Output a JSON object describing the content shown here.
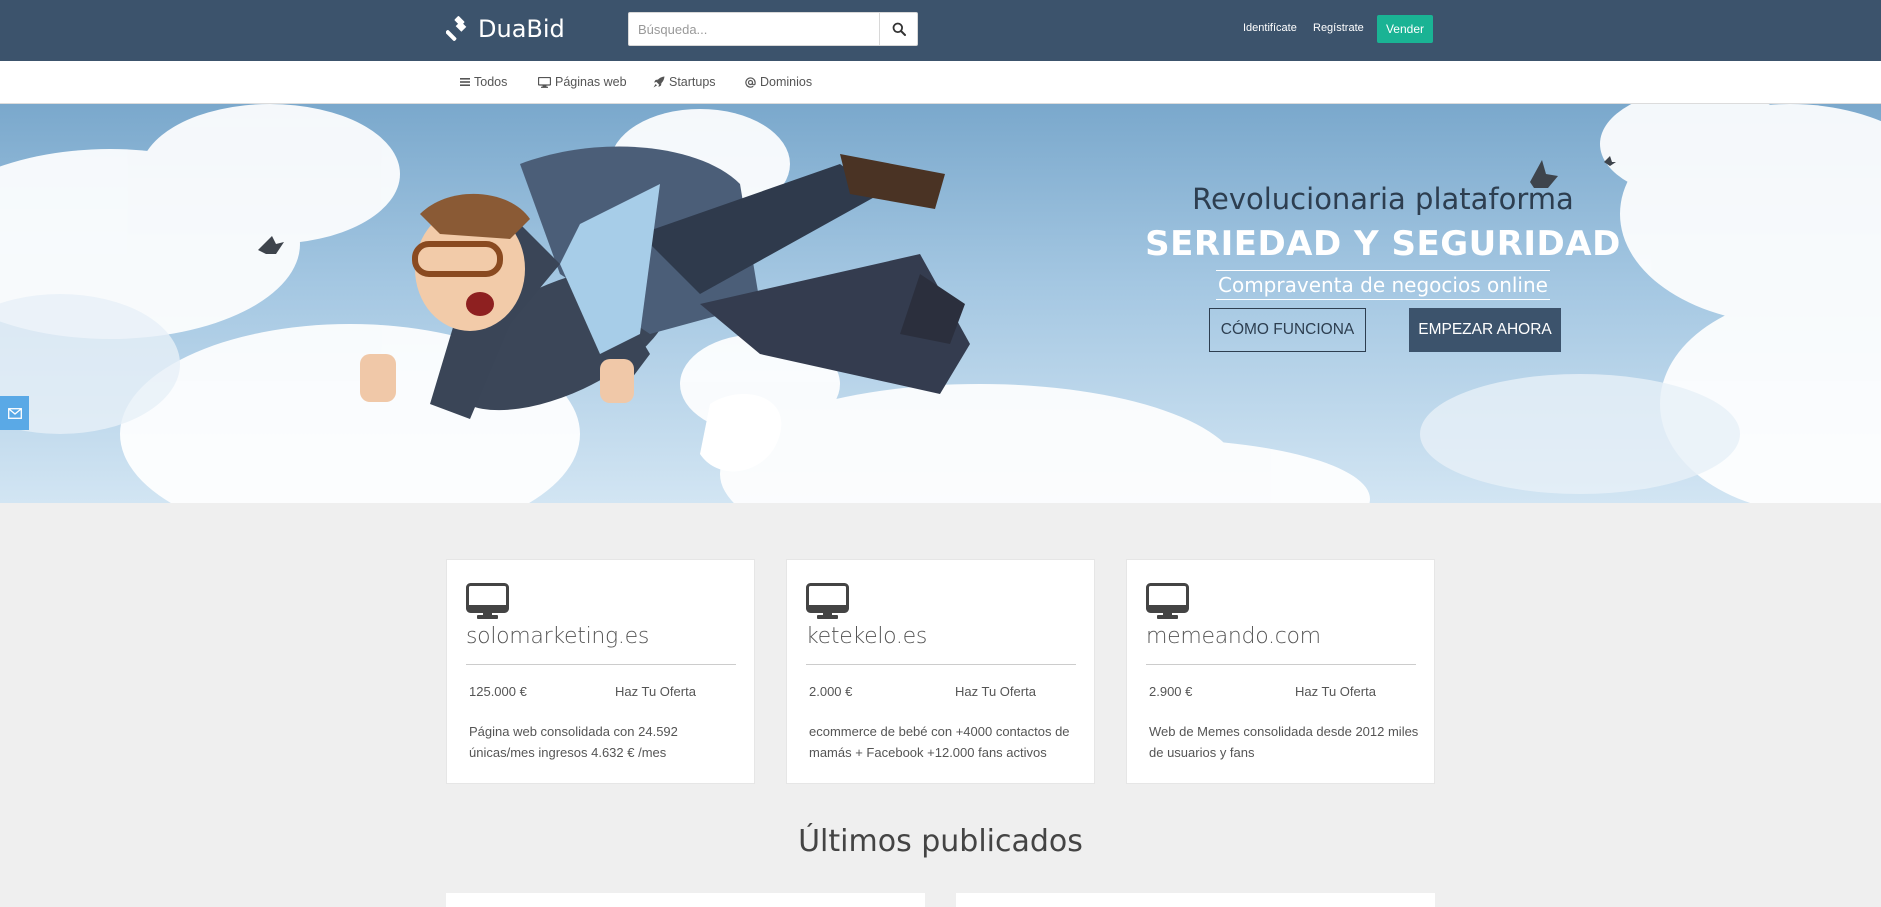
{
  "header": {
    "brand": "DuaBid",
    "search_placeholder": "Búsqueda...",
    "login_label": "Identifícate",
    "register_label": "Regístrate",
    "sell_label": "Vender"
  },
  "subnav": {
    "items": [
      {
        "label": "Todos",
        "icon": "list-icon"
      },
      {
        "label": "Páginas web",
        "icon": "desktop-icon"
      },
      {
        "label": "Startups",
        "icon": "rocket-icon"
      },
      {
        "label": "Dominios",
        "icon": "at-icon"
      }
    ]
  },
  "hero": {
    "title": "Revolucionaria plataforma",
    "subtitle": "SERIEDAD Y SEGURIDAD",
    "tagline": "Compraventa de negocios online",
    "how_label": "CÓMO FUNCIONA",
    "start_label": "EMPEZAR AHORA"
  },
  "listings": [
    {
      "name": "solomarketing.es",
      "price": "125.000 €",
      "offer": "Haz Tu Oferta",
      "description": "Página web consolidada con 24.592 únicas/mes ingresos 4.632 € /mes"
    },
    {
      "name": "ketekelo.es",
      "price": "2.000 €",
      "offer": "Haz Tu Oferta",
      "description": "ecommerce de bebé con +4000 contactos de mamás + Facebook +12.000 fans activos"
    },
    {
      "name": "memeando.com",
      "price": "2.900 €",
      "offer": "Haz Tu Oferta",
      "description": "Web de Memes consolidada desde 2012 miles de usuarios y fans"
    }
  ],
  "section": {
    "title": "Últimos publicados"
  },
  "colors": {
    "header_bg": "#3c536c",
    "sell_button": "#1ab394",
    "start_button": "#3c536c",
    "mail_tab": "#5aa9e6",
    "page_bg": "#efefef"
  }
}
